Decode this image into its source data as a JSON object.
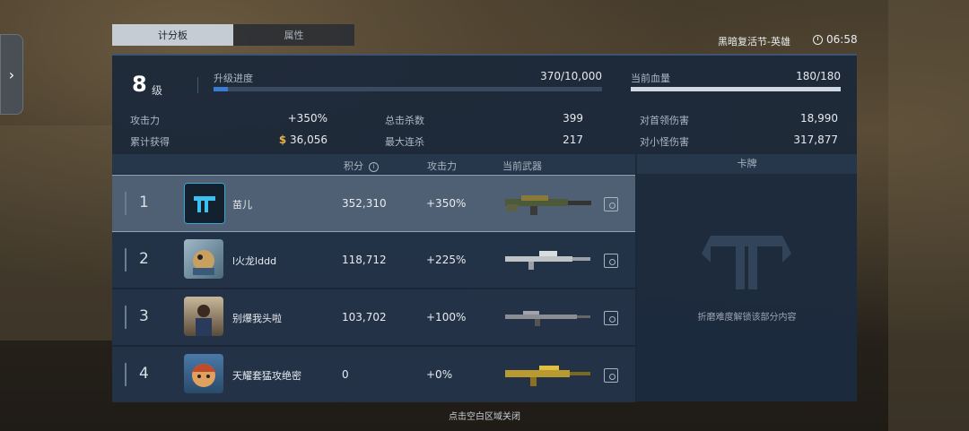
{
  "tabs": [
    {
      "label": "计分板",
      "active": true
    },
    {
      "label": "属性",
      "active": false
    }
  ],
  "event_title": "黑暗复活节-英雄",
  "clock_time": "06:58",
  "level": {
    "number": "8",
    "unit": "级"
  },
  "upgrade": {
    "label": "升级进度",
    "value": "370/10,000",
    "progress": 0.037
  },
  "health": {
    "label": "当前血量",
    "value": "180/180",
    "progress": 1.0
  },
  "stats": {
    "attack_label": "攻击力",
    "attack_value": "+350%",
    "earned_label": "累计获得",
    "earned_currency": "$",
    "earned_value": "36,056",
    "kills_label": "总击杀数",
    "kills_value": "399",
    "streak_label": "最大连杀",
    "streak_value": "217",
    "boss_label": "对首领伤害",
    "boss_value": "18,990",
    "minion_label": "对小怪伤害",
    "minion_value": "317,877"
  },
  "table_headers": {
    "score": "积分",
    "attack": "攻击力",
    "weapon": "当前武器",
    "card": "卡牌"
  },
  "players": [
    {
      "rank": "1",
      "name": "苗儿",
      "score": "352,310",
      "attack": "+350%"
    },
    {
      "rank": "2",
      "name": "l火龙lddd",
      "score": "118,712",
      "attack": "+225%"
    },
    {
      "rank": "3",
      "name": "别爆我头啦",
      "score": "103,702",
      "attack": "+100%"
    },
    {
      "rank": "4",
      "name": "天耀套猛攻绝密",
      "score": "0",
      "attack": "+0%"
    }
  ],
  "card_locked_text": "折磨难度解锁该部分内容",
  "close_hint": "点击空白区域关闭",
  "colors": {
    "progress_blue": "#3a7bd5",
    "health_bar": "#cfd8e2",
    "panel": "#1b283a"
  }
}
